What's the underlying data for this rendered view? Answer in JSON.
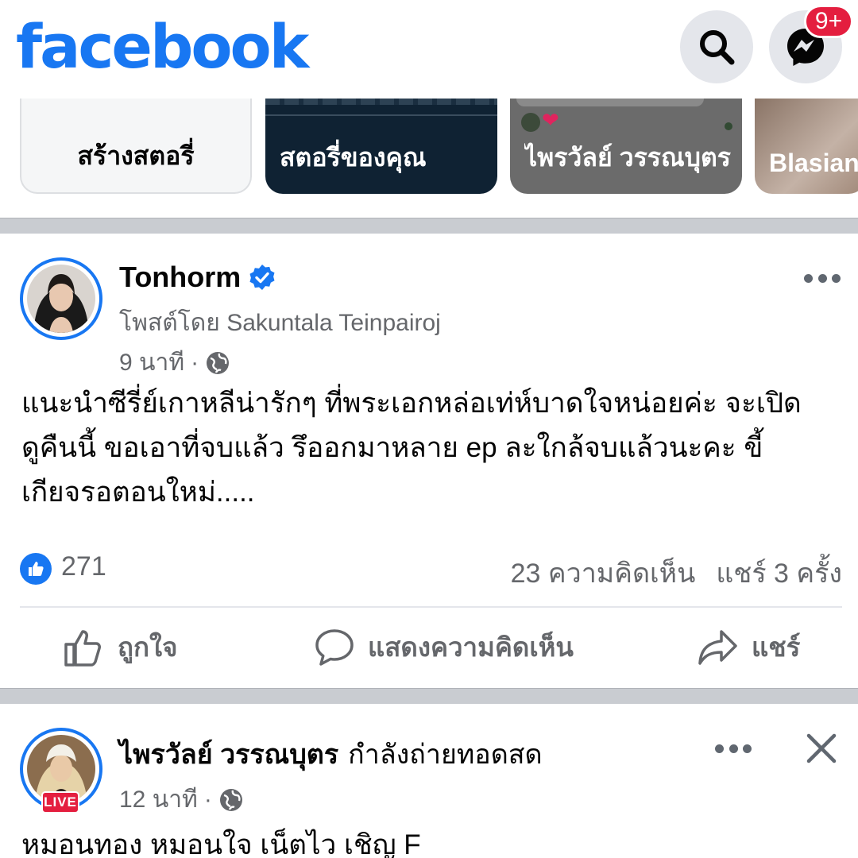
{
  "header": {
    "logo_text": "facebook",
    "search_icon": "search-icon",
    "messenger_icon": "messenger-icon",
    "messenger_badge": "9+",
    "brand_color": "#1877f2",
    "badge_color": "#e41e3f"
  },
  "stories": [
    {
      "label": "สร้างสตอรี่"
    },
    {
      "label": "สตอรี่ของคุณ"
    },
    {
      "label": "ไพรวัลย์ วรรณบุตร"
    },
    {
      "label": "Blasian"
    }
  ],
  "post1": {
    "author": "Tonhorm",
    "verified_icon": "verified-badge-icon",
    "posted_by": "โพสต์โดย Sakuntala Teinpairoj",
    "time": "9 นาที",
    "separator": "·",
    "privacy_icon": "globe-icon",
    "text_lines": [
      "แนะนำซีรี่ย์เกาหลีน่ารักๆ ที่พระเอกหล่อเท่ห์บาดใจหน่อยค่ะ จะเปิด",
      "ดูคืนนี้ ขอเอาที่จบแล้ว รึออกมาหลาย ep ละใกล้จบแล้วนะคะ ขี้",
      "เกียจรอตอนใหม่....."
    ],
    "likes": "271",
    "comments": "23 ความคิดเห็น",
    "shares": "แชร์ 3 ครั้ง",
    "actions": {
      "like": "ถูกใจ",
      "comment": "แสดงความคิดเห็น",
      "share": "แชร์"
    }
  },
  "post2": {
    "author": "ไพรวัลย์ วรรณบุตร",
    "status": "กำลังถ่ายทอดสด",
    "live_label": "LIVE",
    "time": "12 นาที",
    "separator": "·",
    "privacy_icon": "globe-icon",
    "text": "หมอนทอง หมอนใจ เน็ตไว เชิญ F"
  }
}
